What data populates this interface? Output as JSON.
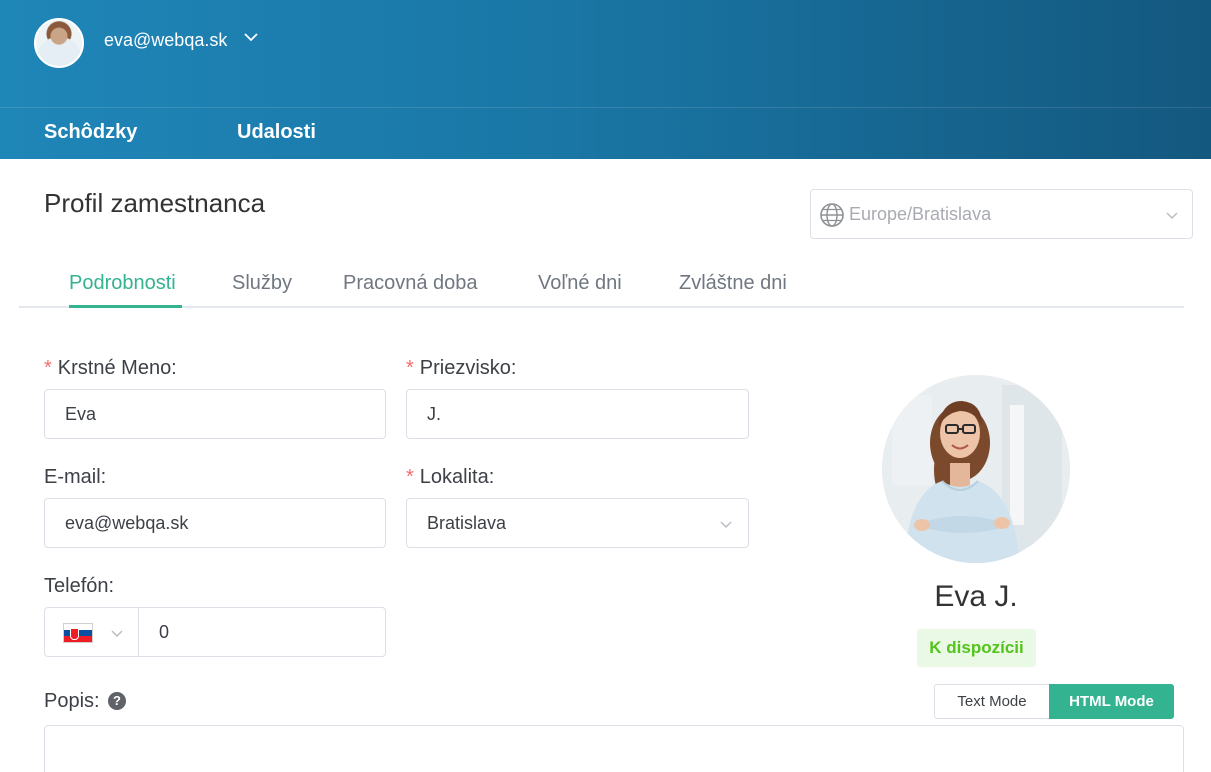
{
  "header": {
    "user_email": "eva@webqa.sk",
    "nav": [
      "Schôdzky",
      "Udalosti"
    ]
  },
  "page": {
    "title": "Profil zamestnanca",
    "timezone": "Europe/Bratislava"
  },
  "tabs": [
    {
      "label": "Podrobnosti",
      "active": true
    },
    {
      "label": "Služby",
      "active": false
    },
    {
      "label": "Pracovná doba",
      "active": false
    },
    {
      "label": "Voľné dni",
      "active": false
    },
    {
      "label": "Zvláštne dni",
      "active": false
    }
  ],
  "form": {
    "first_name": {
      "label": "Krstné Meno:",
      "value": "Eva",
      "required": true
    },
    "last_name": {
      "label": "Priezvisko:",
      "value": "J.",
      "required": true
    },
    "email": {
      "label": "E-mail:",
      "value": "eva@webqa.sk"
    },
    "location": {
      "label": "Lokalita:",
      "value": "Bratislava",
      "required": true
    },
    "phone": {
      "label": "Telefón:",
      "value": "0",
      "country": "Slovakia"
    },
    "description": {
      "label": "Popis:",
      "help": "?"
    },
    "required_mark": "*"
  },
  "profile": {
    "name": "Eva J.",
    "status": "K dispozícii"
  },
  "editor_modes": {
    "text": "Text Mode",
    "html": "HTML Mode",
    "active": "html"
  },
  "colors": {
    "accent": "#33b390",
    "header": "#1a77a6",
    "required": "#f56c6c",
    "status": "#52c41a"
  }
}
